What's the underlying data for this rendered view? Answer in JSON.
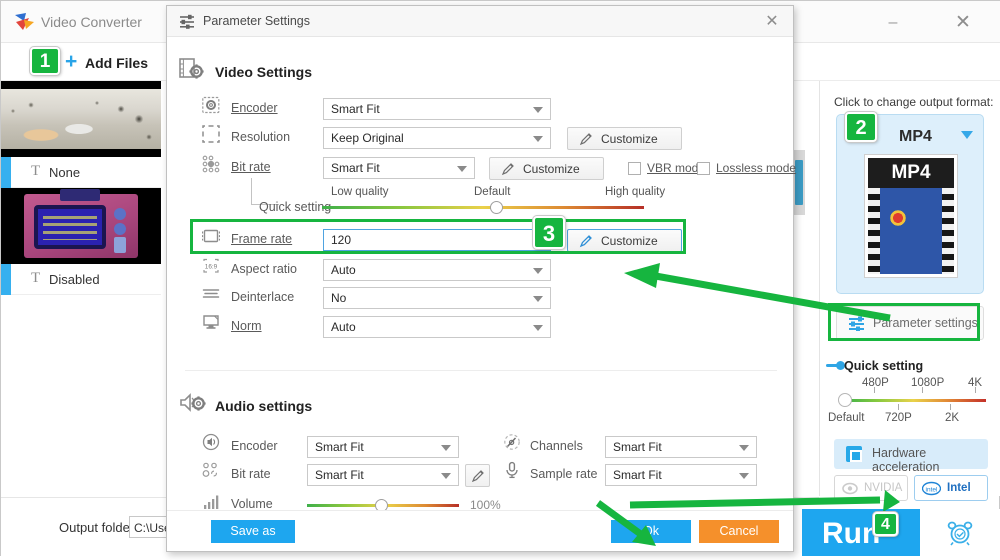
{
  "app": {
    "title": "Video Converter",
    "logo_icon": "app-logo-icon",
    "minimize_icon": "–",
    "close_icon": "✕",
    "add_files_label": "Add Files",
    "add_files_icon": "plus-icon",
    "output_folder_label": "Output folder:",
    "output_folder_value": "C:\\Use",
    "run_label": "Run",
    "alarm_icon": "alarm-clock-icon"
  },
  "file_list": [
    {
      "thumb": "snow-village-thumbnail",
      "text_icon": "T",
      "label": "None"
    },
    {
      "thumb": "retro-tv-thumbnail",
      "text_icon": "T",
      "label": "Disabled"
    }
  ],
  "right_panel": {
    "hint": "Click to change output format:",
    "format_name": "MP4",
    "format_thumb_label": "MP4",
    "parameter_settings_label": "Parameter settings",
    "parameter_settings_icon": "sliders-icon",
    "quick_setting_label": "Quick setting",
    "quick_setting_ticks_top": [
      "480P",
      "1080P",
      "4K"
    ],
    "quick_setting_ticks_bottom": [
      "Default",
      "720P",
      "2K"
    ],
    "hardware_acceleration_label": "Hardware acceleration",
    "hardware_acceleration_icon": "cpu-chip-icon",
    "vendors": [
      {
        "label": "NVIDIA",
        "enabled": false
      },
      {
        "label": "Intel",
        "enabled": true
      }
    ]
  },
  "dialog": {
    "title": "Parameter Settings",
    "title_icon": "sliders-icon",
    "close_icon": "✕",
    "video_section": {
      "heading": "Video Settings",
      "icon": "film-gear-icon",
      "rows": [
        {
          "label": "Encoder",
          "icon": "film-gear-small-icon",
          "value": "Smart Fit",
          "control": "combo"
        },
        {
          "label": "Resolution",
          "icon": "crop-frame-icon",
          "value": "Keep Original",
          "control": "combo",
          "button": "Customize"
        },
        {
          "label": "Bit rate",
          "icon": "dots-icon",
          "value": "Smart Fit",
          "control": "combo",
          "button": "Customize"
        },
        {
          "label": "Frame rate",
          "icon": "frame-icon",
          "value": "120",
          "control": "textbox",
          "button": "Customize"
        },
        {
          "label": "Aspect ratio",
          "icon": "aspect-169-icon",
          "value": "Auto",
          "control": "combo"
        },
        {
          "label": "Deinterlace",
          "icon": "lines-icon",
          "value": "No",
          "control": "combo"
        },
        {
          "label": "Norm",
          "icon": "monitor-icon",
          "value": "Auto",
          "control": "combo"
        }
      ],
      "vbr_mode_label": "VBR mode",
      "vbr_mode_checked": false,
      "lossless_mode_label": "Lossless mode",
      "lossless_mode_checked": false,
      "quick_setting_label": "Quick setting",
      "quality_labels": [
        "Low quality",
        "Default",
        "High quality"
      ]
    },
    "audio_section": {
      "heading": "Audio settings",
      "icon": "speaker-gear-icon",
      "rows_left": [
        {
          "label": "Encoder",
          "icon": "speaker-icon",
          "value": "Smart Fit"
        },
        {
          "label": "Bit rate",
          "icon": "dots-icon",
          "value": "Smart Fit"
        }
      ],
      "rows_right": [
        {
          "label": "Channels",
          "icon": "channels-icon",
          "value": "Smart Fit"
        },
        {
          "label": "Sample rate",
          "icon": "mic-icon",
          "value": "Smart Fit"
        }
      ],
      "volume_label": "Volume",
      "volume_icon": "bars-icon",
      "volume_value": "100%"
    },
    "footer": {
      "save_as": "Save as",
      "ok": "Ok",
      "cancel": "Cancel"
    }
  },
  "annotations": {
    "badges": [
      "1",
      "2",
      "3",
      "4"
    ]
  },
  "colors": {
    "accent_blue": "#1ea6ef",
    "annotation_green": "#16b53f",
    "cancel_orange": "#f5902b"
  }
}
